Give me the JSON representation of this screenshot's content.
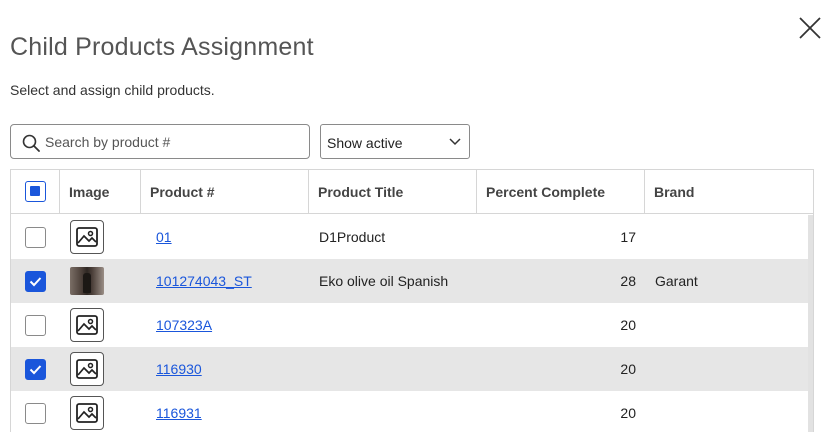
{
  "dialog": {
    "title": "Child Products Assignment",
    "subtitle": "Select and assign child products."
  },
  "search": {
    "placeholder": "Search by product #",
    "value": ""
  },
  "filter": {
    "selected": "Show active"
  },
  "table": {
    "headers": {
      "image": "Image",
      "product": "Product #",
      "title": "Product Title",
      "percent": "Percent Complete",
      "brand": "Brand"
    },
    "rows": [
      {
        "product": "01",
        "title": "D1Product",
        "percent": "17",
        "brand": "",
        "checked": false,
        "image": "placeholder-image-icon"
      },
      {
        "product": "101274043_ST",
        "title": "Eko olive oil Spanish",
        "percent": "28",
        "brand": "Garant",
        "checked": true,
        "image": "product-photo"
      },
      {
        "product": "107323A",
        "title": "",
        "percent": "20",
        "brand": "",
        "checked": false,
        "image": "placeholder-image-icon"
      },
      {
        "product": "116930",
        "title": "",
        "percent": "20",
        "brand": "",
        "checked": true,
        "image": "placeholder-image-icon"
      },
      {
        "product": "116931",
        "title": "",
        "percent": "20",
        "brand": "",
        "checked": false,
        "image": "placeholder-image-icon"
      }
    ]
  },
  "colors": {
    "accent": "#1a56db",
    "selected_row": "#e6e6e6"
  }
}
